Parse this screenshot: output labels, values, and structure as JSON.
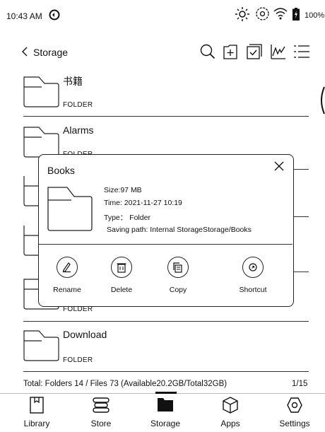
{
  "status": {
    "time": "10:43 AM",
    "battery": "100%"
  },
  "header": {
    "back_label": "Storage"
  },
  "folders": [
    {
      "name": "书籍",
      "type": "FOLDER"
    },
    {
      "name": "Alarms",
      "type": "FOLDER"
    },
    {
      "name": "",
      "type": "FOLDER"
    },
    {
      "name": "Download",
      "type": "FOLDER"
    }
  ],
  "dialog": {
    "title": "Books",
    "size": "Size:97 MB",
    "time": "Time: 2021-11-27 10:19",
    "type": "Type： Folder",
    "path": "Saving path: Internal StorageStorage/Books",
    "actions": [
      "Rename",
      "Delete",
      "Copy",
      "Shortcut"
    ]
  },
  "footer": {
    "summary": "Total: Folders 14 / Files 73 (Available20.2GB/Total32GB)",
    "page": "1/15"
  },
  "nav": [
    "Library",
    "Store",
    "Storage",
    "Apps",
    "Settings"
  ]
}
